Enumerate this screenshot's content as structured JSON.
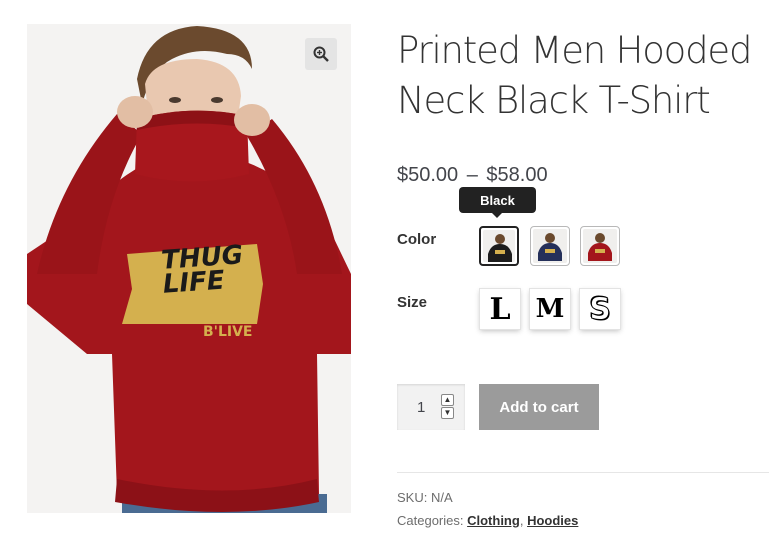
{
  "product": {
    "title": "Printed Men Hooded Neck Black T-Shirt",
    "price_min": "$50.00",
    "price_separator": "–",
    "price_max": "$58.00",
    "shirt_print_line1": "THUG",
    "shirt_print_line2": "LIFE",
    "shirt_print_line3": "B'LIVE"
  },
  "variations": {
    "color": {
      "label": "Color",
      "tooltip": "Black",
      "options": [
        {
          "name": "Black",
          "color": "#1d1d1d"
        },
        {
          "name": "Navy",
          "color": "#25305a"
        },
        {
          "name": "Red",
          "color": "#a3161c"
        }
      ]
    },
    "size": {
      "label": "Size",
      "options": [
        "L",
        "M",
        "S"
      ]
    }
  },
  "cart": {
    "quantity": "1",
    "add_to_cart_label": "Add to cart"
  },
  "meta": {
    "sku_label": "SKU:",
    "sku_value": "N/A",
    "categories_label": "Categories:",
    "category_1": "Clothing",
    "category_separator": ",",
    "category_2": "Hoodies"
  },
  "colors": {
    "hoodie_red": "#a3161c",
    "button_gray": "#9b9b9b",
    "tooltip_bg": "#222222"
  }
}
